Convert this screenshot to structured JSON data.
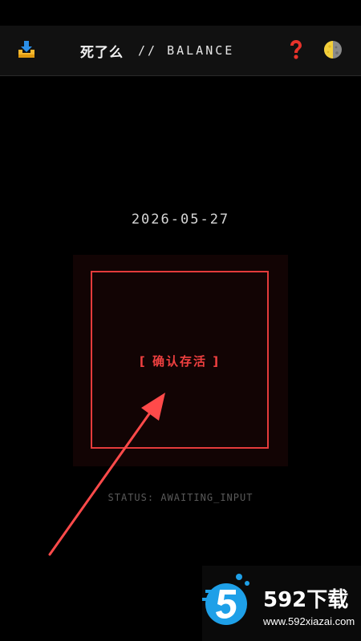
{
  "header": {
    "title_cn": "死了么",
    "title_en": "// BALANCE",
    "icons": {
      "download": "download-icon",
      "help": "question-mark-icon",
      "theme": "moon-phase-icon"
    }
  },
  "main": {
    "date": "2026-05-27",
    "confirm_label": "[  确认存活  ]",
    "status": "STATUS: AWAITING_INPUT"
  },
  "overlay": {
    "annotation": "red-arrow-annotation"
  },
  "watermark": {
    "brand": "592下载",
    "url": "www.592xiazai.com"
  },
  "colors": {
    "background": "#000000",
    "header_bg": "#111111",
    "accent_red": "#e43b3b",
    "status_gray": "#5a5a5a",
    "watermark_blue": "#1ea0e8"
  }
}
